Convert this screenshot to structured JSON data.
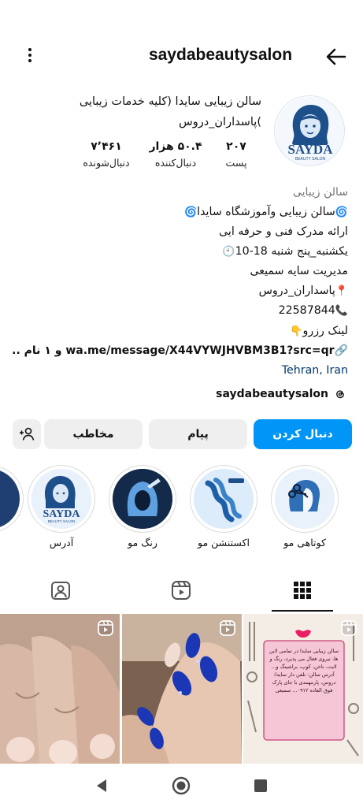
{
  "header": {
    "username": "saydabeautysalon",
    "more_icon": "more-vertical-icon",
    "back_icon": "arrow-back-icon"
  },
  "profile": {
    "full_name": "سالن زیبایی سایدا (کلیه خدمات زیبایی )پاسداران_دروس",
    "avatar_logo_text": "SAYDA",
    "avatar_logo_subtext": "BEAUTY SALON",
    "stats": {
      "posts_value": "۲۰۷",
      "posts_label": "پست",
      "followers_value": "۵۰.۴ هزار",
      "followers_label": "دنبال‌کننده",
      "following_value": "۷٬۴۶۱",
      "following_label": "دنبال‌شونده"
    }
  },
  "bio": {
    "category": "سالن زیبایی",
    "line1": "سالن زیبایی وآموزشگاه سایدا",
    "line2": "ارائه مدرک فنی و حرفه ایی",
    "line3": "یکشنبه_پنج شنبه 18-10",
    "line4": "مدیریت سایه سمیعی",
    "line5": "پاسداران_دروس",
    "line6": "22587844",
    "line7": "لینک رزرو",
    "link_text": "wa.me/message/X44VYWJHVBM3B1?src=qr",
    "link_suffix": "و ۱ نام ...",
    "location": "Tehran, Iran"
  },
  "threads": {
    "label": "saydabeautysalon",
    "icon": "threads-icon"
  },
  "actions": {
    "follow_label": "دنبال کردن",
    "message_label": "پیام",
    "contact_label": "مخاطب",
    "add_user_icon": "add-user-icon"
  },
  "highlights": [
    {
      "label": "آدرس",
      "icon": "sayda-logo"
    },
    {
      "label": "رنگ مو",
      "icon": "hair-color"
    },
    {
      "label": "اکستنشن مو",
      "icon": "hair-extension"
    },
    {
      "label": "کوتاهی مو",
      "icon": "haircut"
    }
  ],
  "tabs": {
    "grid_icon": "grid-icon",
    "reels_icon": "reels-icon",
    "tagged_icon": "tagged-icon"
  },
  "posts": {
    "post1_caption": "سالن زیبایی سایدا در تمامی لاین ها، نیروی فعال می پذیرد، رنگ و لایت، ناخن، کوپ، براشینگ و... آدرس سالن: تلفن دار سایدا: دروس، پارمهمدی با جای پارک فوق العاده ۰۹۱۲... سمیعی"
  },
  "navbar": {
    "back_icon": "nav-back-icon",
    "home_icon": "nav-home-icon",
    "recents_icon": "nav-recents-icon"
  },
  "colors": {
    "accent": "#0095f6",
    "button_gray": "#efefef",
    "link_blue": "#00376b",
    "muted": "#737373"
  }
}
